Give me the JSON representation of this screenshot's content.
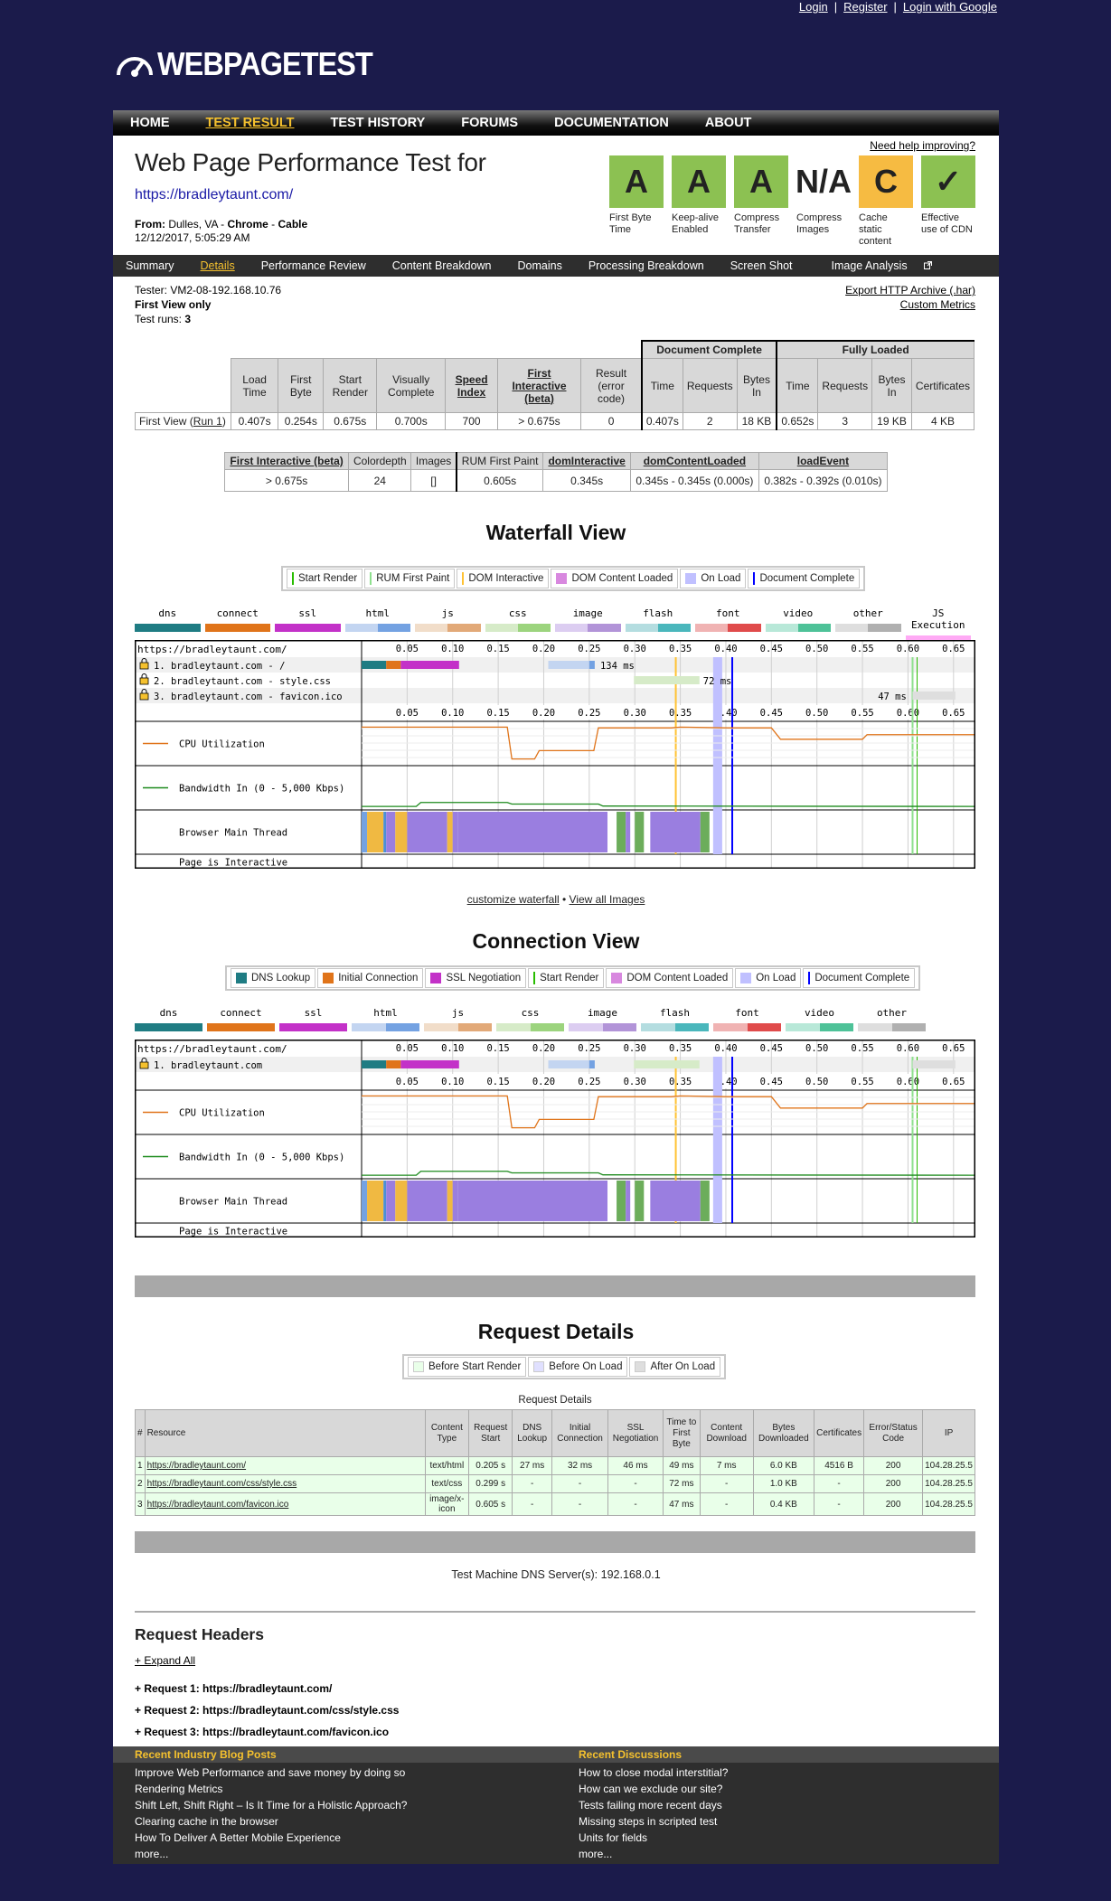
{
  "toplinks": {
    "login": "Login",
    "register": "Register",
    "google": "Login with Google",
    "sep": "|"
  },
  "logo": {
    "text": "WEBPAGETEST",
    "icon": "speedometer-icon"
  },
  "nav": [
    "HOME",
    "TEST RESULT",
    "TEST HISTORY",
    "FORUMS",
    "DOCUMENTATION",
    "ABOUT"
  ],
  "header": {
    "help": "Need help improving?",
    "title": "Web Page Performance Test for",
    "url": "https://bradleytaunt.com/",
    "from_label": "From:",
    "from_loc": "Dulles, VA - ",
    "from_browser": "Chrome",
    "from_sep": " - ",
    "from_conn": "Cable",
    "date": "12/12/2017, 5:05:29 AM"
  },
  "grades": [
    {
      "grade": "A",
      "color": "#8cc152",
      "label": "First Byte Time"
    },
    {
      "grade": "A",
      "color": "#8cc152",
      "label": "Keep-alive Enabled"
    },
    {
      "grade": "A",
      "color": "#8cc152",
      "label": "Compress Transfer"
    },
    {
      "grade": "N/A",
      "color": "#ffffff",
      "label": "Compress Images"
    },
    {
      "grade": "C",
      "color": "#f6bb42",
      "label": "Cache static content"
    },
    {
      "grade": "✓",
      "color": "#8cc152",
      "label": "Effective use of CDN"
    }
  ],
  "subnav": [
    "Summary",
    "Details",
    "Performance Review",
    "Content Breakdown",
    "Domains",
    "Processing Breakdown",
    "Screen Shot",
    "Image Analysis"
  ],
  "tester": {
    "tester": "Tester: VM2-08-192.168.10.76",
    "view": "First View only",
    "runs_label": "Test runs: ",
    "runs": "3"
  },
  "export": {
    "har": "Export HTTP Archive (.har)",
    "metrics": "Custom Metrics"
  },
  "results": {
    "group_doc": "Document Complete",
    "group_full": "Fully Loaded",
    "headers": [
      "Load Time",
      "First Byte",
      "Start Render",
      "Visually Complete",
      "Speed Index",
      "First Interactive (beta)",
      "Result (error code)",
      "Time",
      "Requests",
      "Bytes In",
      "Time",
      "Requests",
      "Bytes In",
      "Certificates"
    ],
    "row_label": "First View (",
    "row_link": "Run 1",
    "row_close": ")",
    "row": [
      "0.407s",
      "0.254s",
      "0.675s",
      "0.700s",
      "700",
      "> 0.675s",
      "0",
      "0.407s",
      "2",
      "18 KB",
      "0.652s",
      "3",
      "19 KB",
      "4 KB"
    ]
  },
  "results2": {
    "headers": [
      "First Interactive (beta)",
      "Colordepth",
      "Images",
      "RUM First Paint",
      "domInteractive",
      "domContentLoaded",
      "loadEvent"
    ],
    "row": [
      "> 0.675s",
      "24",
      "[]",
      "0.605s",
      "0.345s",
      "0.345s - 0.345s (0.000s)",
      "0.382s - 0.392s (0.010s)"
    ]
  },
  "waterfall": {
    "title": "Waterfall View",
    "legend": [
      {
        "label": "Start Render",
        "color": "#28bc00",
        "kind": "line"
      },
      {
        "label": "RUM First Paint",
        "color": "#8ee08e",
        "kind": "line"
      },
      {
        "label": "DOM Interactive",
        "color": "#ffc233",
        "kind": "line"
      },
      {
        "label": "DOM Content Loaded",
        "color": "#d888df",
        "kind": "box"
      },
      {
        "label": "On Load",
        "color": "#c0c0ff",
        "kind": "box"
      },
      {
        "label": "Document Complete",
        "color": "#0000ff",
        "kind": "line"
      }
    ],
    "categories": [
      {
        "name": "dns",
        "c1": "#1f7c83",
        "c2": "#1f7c83"
      },
      {
        "name": "connect",
        "c1": "#e0741a",
        "c2": "#e0741a"
      },
      {
        "name": "ssl",
        "c1": "#c331c8",
        "c2": "#c331c8"
      },
      {
        "name": "html",
        "c1": "#c3d5f1",
        "c2": "#74a2e2"
      },
      {
        "name": "js",
        "c1": "#f1ddc9",
        "c2": "#e2a978"
      },
      {
        "name": "css",
        "c1": "#d6ebc8",
        "c2": "#9cd47e"
      },
      {
        "name": "image",
        "c1": "#dccdf1",
        "c2": "#b294d8"
      },
      {
        "name": "flash",
        "c1": "#b4dde0",
        "c2": "#4ab7bc"
      },
      {
        "name": "font",
        "c1": "#f0b3b3",
        "c2": "#e04b4b"
      },
      {
        "name": "video",
        "c1": "#b8e8d8",
        "c2": "#4ec298"
      },
      {
        "name": "other",
        "c1": "#dedede",
        "c2": "#b0b0b0"
      },
      {
        "name": "JS Execution",
        "c1": "#ffaaf5",
        "c2": "#ffaaf5"
      }
    ],
    "ticks": [
      "0.05",
      "0.10",
      "0.15",
      "0.20",
      "0.25",
      "0.30",
      "0.35",
      "0.40",
      "0.45",
      "0.50",
      "0.55",
      "0.60",
      "0.65"
    ],
    "page_url": "https://bradleytaunt.com/",
    "requests": [
      {
        "label": "1. bradleytaunt.com - /",
        "time": "134 ms"
      },
      {
        "label": "2. bradleytaunt.com - style.css",
        "time": "72 ms"
      },
      {
        "label": "3. bradleytaunt.com - favicon.ico",
        "time": "47 ms"
      }
    ],
    "rows": {
      "cpu": "CPU Utilization",
      "bw": "Bandwidth In (0 - 5,000 Kbps)",
      "main": "Browser Main Thread",
      "interactive": "Page is Interactive"
    }
  },
  "links": {
    "customize": "customize waterfall",
    "bullet": " • ",
    "images": "View all Images"
  },
  "connection": {
    "title": "Connection View",
    "legend": [
      {
        "label": "DNS Lookup",
        "color": "#1f7c83",
        "kind": "box"
      },
      {
        "label": "Initial Connection",
        "color": "#e0741a",
        "kind": "box"
      },
      {
        "label": "SSL Negotiation",
        "color": "#c331c8",
        "kind": "box"
      },
      {
        "label": "Start Render",
        "color": "#28bc00",
        "kind": "line"
      },
      {
        "label": "DOM Content Loaded",
        "color": "#d888df",
        "kind": "box"
      },
      {
        "label": "On Load",
        "color": "#c0c0ff",
        "kind": "box"
      },
      {
        "label": "Document Complete",
        "color": "#0000ff",
        "kind": "line"
      }
    ],
    "row": "1. bradleytaunt.com"
  },
  "request_details": {
    "title": "Request Details",
    "legend": [
      {
        "label": "Before Start Render",
        "color": "#e9ffe9"
      },
      {
        "label": "Before On Load",
        "color": "#e0e0ff"
      },
      {
        "label": "After On Load",
        "color": "#dedede"
      }
    ],
    "caption": "Request Details",
    "headers": [
      "#",
      "Resource",
      "Content Type",
      "Request Start",
      "DNS Lookup",
      "Initial Connection",
      "SSL Negotiation",
      "Time to First Byte",
      "Content Download",
      "Bytes Downloaded",
      "Certificates",
      "Error/Status Code",
      "IP"
    ],
    "rows": [
      [
        "1",
        "https://bradleytaunt.com/",
        "text/html",
        "0.205 s",
        "27 ms",
        "32 ms",
        "46 ms",
        "49 ms",
        "7 ms",
        "6.0 KB",
        "4516 B",
        "200",
        "104.28.25.5"
      ],
      [
        "2",
        "https://bradleytaunt.com/css/style.css",
        "text/css",
        "0.299 s",
        "-",
        "-",
        "-",
        "72 ms",
        "-",
        "1.0 KB",
        "-",
        "200",
        "104.28.25.5"
      ],
      [
        "3",
        "https://bradleytaunt.com/favicon.ico",
        "image/x-icon",
        "0.605 s",
        "-",
        "-",
        "-",
        "47 ms",
        "-",
        "0.4 KB",
        "-",
        "200",
        "104.28.25.5"
      ]
    ]
  },
  "dns": "Test Machine DNS Server(s): 192.168.0.1",
  "request_headers": {
    "title": "Request Headers",
    "expand": "+ Expand All",
    "items": [
      "+ Request 1: https://bradleytaunt.com/",
      "+ Request 2: https://bradleytaunt.com/css/style.css",
      "+ Request 3: https://bradleytaunt.com/favicon.ico"
    ]
  },
  "footer": {
    "blog_title": "Recent Industry Blog Posts",
    "blog": [
      "Improve Web Performance and save money by doing so",
      "Rendering Metrics",
      "Shift Left, Shift Right – Is It Time for a Holistic Approach?",
      "Clearing cache in the browser",
      "How To Deliver A Better Mobile Experience",
      "more..."
    ],
    "disc_title": "Recent Discussions",
    "disc": [
      "How to close modal interstitial?",
      "How can we exclude our site?",
      "Tests failing more recent days",
      "Missing steps in scripted test",
      "Units for fields",
      "more..."
    ]
  }
}
